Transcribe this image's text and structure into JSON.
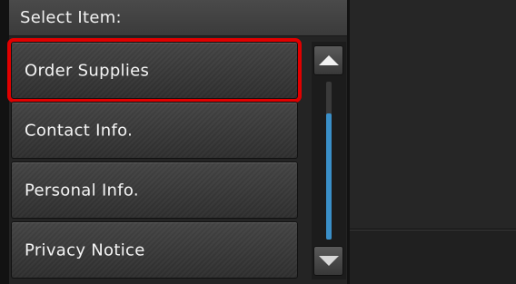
{
  "header": {
    "title": "Select Item:"
  },
  "items": [
    {
      "label": "Order Supplies",
      "selected": true
    },
    {
      "label": "Contact Info.",
      "selected": false
    },
    {
      "label": "Personal Info.",
      "selected": false
    },
    {
      "label": "Privacy Notice",
      "selected": false
    }
  ],
  "scrollbar": {
    "up_icon": "triangle-up-icon",
    "down_icon": "triangle-down-icon",
    "thumb_start_fraction": 0.2,
    "thumb_end_fraction": 1.0
  },
  "colors": {
    "selection_outline": "#e00000",
    "scroll_thumb": "#3a8fc8"
  }
}
